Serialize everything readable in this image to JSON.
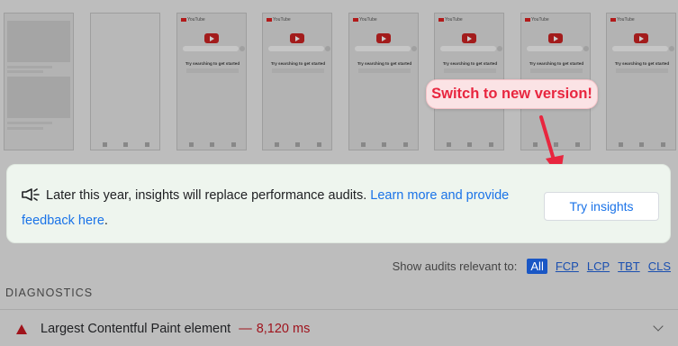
{
  "filmstrip": {
    "frames": [
      {
        "kind": "loading"
      },
      {
        "kind": "blank"
      },
      {
        "kind": "youtube",
        "header": "YouTube",
        "message": "Try searching to get started"
      },
      {
        "kind": "youtube",
        "header": "YouTube",
        "message": "Try searching to get started"
      },
      {
        "kind": "youtube",
        "header": "YouTube",
        "message": "Try searching to get started"
      },
      {
        "kind": "youtube",
        "header": "YouTube",
        "message": "Try searching to get started"
      },
      {
        "kind": "youtube",
        "header": "YouTube",
        "message": "Try searching to get started"
      },
      {
        "kind": "youtube",
        "header": "YouTube",
        "message": "Try searching to get started"
      }
    ]
  },
  "callout": {
    "text": "Switch to new version!",
    "color": "#e8263f"
  },
  "banner": {
    "icon": "megaphone-icon",
    "text": "Later this year, insights will replace performance audits.",
    "link": "Learn more and provide feedback here",
    "period": ".",
    "button": "Try insights"
  },
  "filters": {
    "label": "Show audits relevant to:",
    "options": [
      "All",
      "FCP",
      "LCP",
      "TBT",
      "CLS"
    ],
    "active": "All"
  },
  "diagnostics": {
    "title": "DIAGNOSTICS",
    "audit": {
      "name": "Largest Contentful Paint element",
      "separator": "—",
      "value": "8,120 ms",
      "status_color": "#a0131b"
    }
  }
}
